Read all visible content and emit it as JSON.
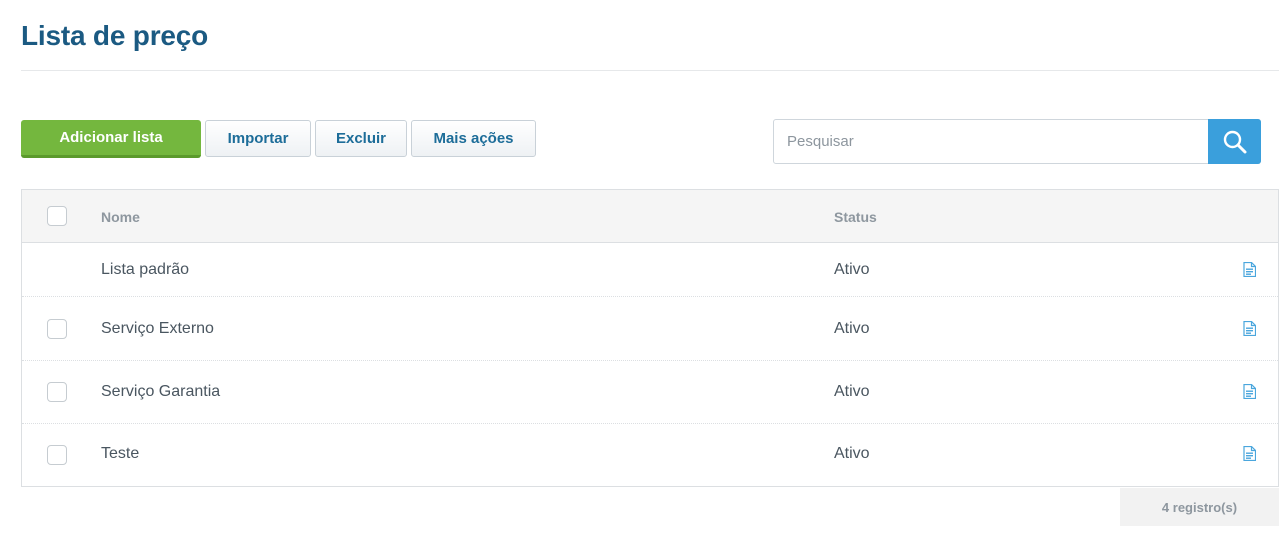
{
  "page": {
    "title": "Lista de preço"
  },
  "toolbar": {
    "add_label": "Adicionar lista",
    "import_label": "Importar",
    "delete_label": "Excluir",
    "more_label": "Mais ações"
  },
  "search": {
    "placeholder": "Pesquisar",
    "value": ""
  },
  "table": {
    "columns": {
      "name": "Nome",
      "status": "Status"
    },
    "rows": [
      {
        "name": "Lista padrão",
        "status": "Ativo",
        "selectable": false
      },
      {
        "name": "Serviço Externo",
        "status": "Ativo",
        "selectable": true
      },
      {
        "name": "Serviço Garantia",
        "status": "Ativo",
        "selectable": true
      },
      {
        "name": "Teste",
        "status": "Ativo",
        "selectable": true
      }
    ]
  },
  "footer": {
    "count_label": "4 registro(s)"
  },
  "icons": {
    "search": "search-icon",
    "row_action": "document-icon"
  },
  "colors": {
    "title": "#1b5a82",
    "primary": "#74b73e",
    "search": "#3a9fdc",
    "link": "#1d6d99"
  }
}
